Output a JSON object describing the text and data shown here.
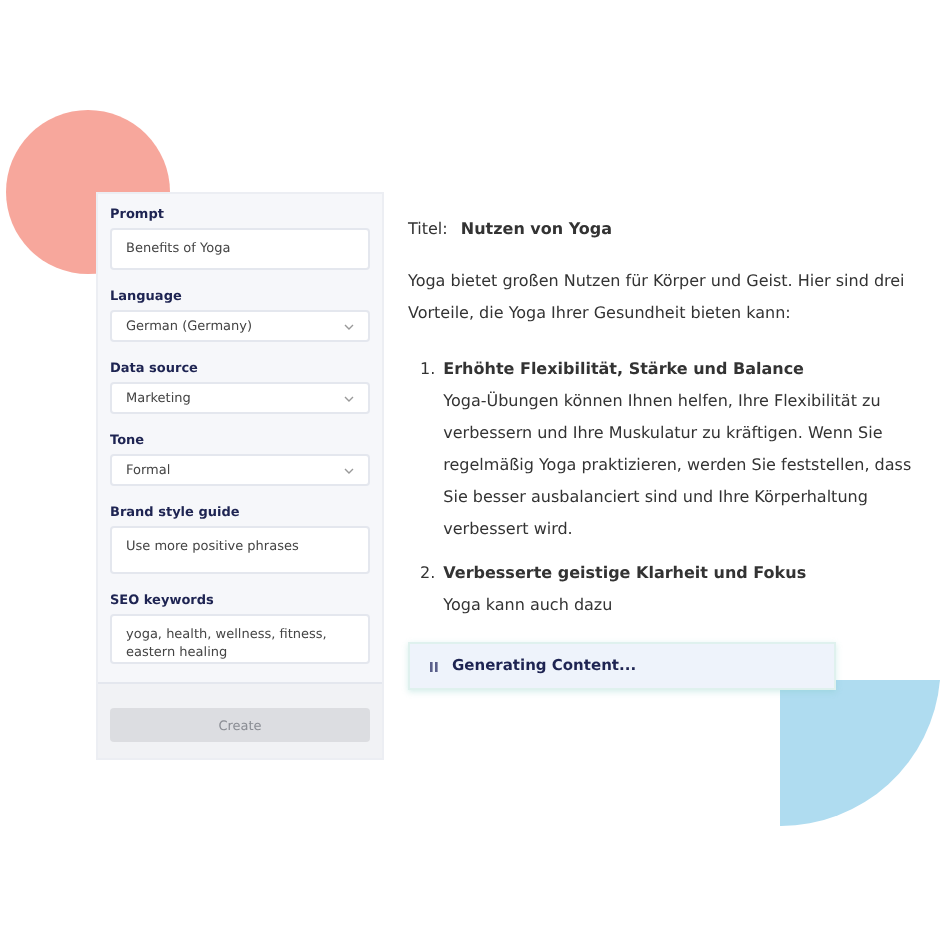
{
  "form": {
    "fields": [
      {
        "label": "Prompt",
        "kind": "text",
        "value": "Benefits of Yoga"
      },
      {
        "label": "Language",
        "kind": "select",
        "value": "German (Germany)"
      },
      {
        "label": "Data source",
        "kind": "select",
        "value": "Marketing"
      },
      {
        "label": "Tone",
        "kind": "select",
        "value": "Formal"
      },
      {
        "label": "Brand style guide",
        "kind": "textarea",
        "value": "Use more positive phrases"
      },
      {
        "label": "SEO keywords",
        "kind": "text",
        "value": "yoga, health, wellness, fitness, eastern healing"
      }
    ],
    "button": {
      "label": "Create",
      "disabled": true
    }
  },
  "document": {
    "title_label": "Titel:",
    "title": "Nutzen von Yoga",
    "intro": "Yoga bietet großen Nutzen für Körper und Geist. Hier sind drei Vorteile, die Yoga Ihrer Gesundheit bieten kann:",
    "items": [
      {
        "number": "1.",
        "heading": "Erhöhte Flexibilität, Stärke und Balance",
        "body": "Yoga-Übungen können Ihnen helfen, Ihre Flexibilität zu verbessern und Ihre Muskulatur zu kräftigen. Wenn Sie regelmäßig Yoga praktizieren, werden Sie feststellen, dass Sie besser ausbalanciert sind und Ihre Körperhaltung verbessert wird."
      },
      {
        "number": "2.",
        "heading": "Verbesserte geistige Klarheit und Fokus",
        "body": "Yoga kann auch dazu"
      }
    ]
  },
  "status": {
    "text": "Generating Content..."
  }
}
